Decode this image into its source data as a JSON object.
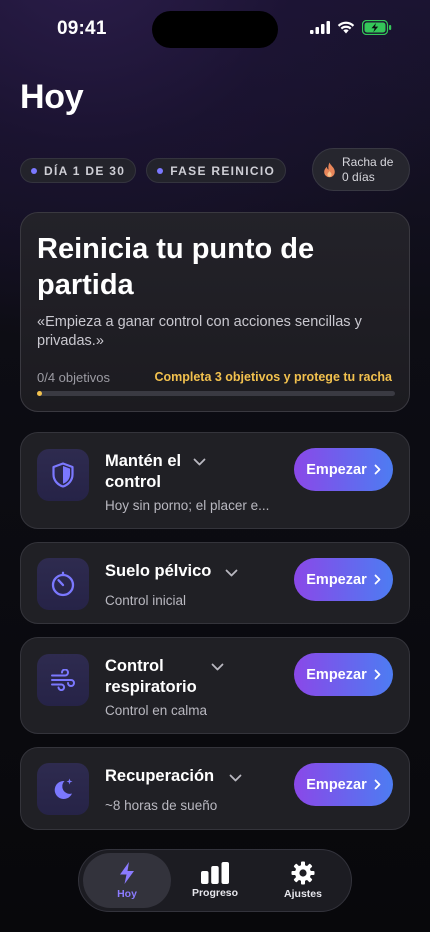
{
  "status_bar": {
    "time": "09:41"
  },
  "page": {
    "title": "Hoy"
  },
  "badges": {
    "day": "DÍA 1 DE 30",
    "phase": "FASE REINICIO"
  },
  "streak": {
    "line1": "Racha de",
    "line2": "0 días"
  },
  "hero": {
    "title": "Reinicia tu punto de partida",
    "quote": "«Empieza a ganar control con acciones sencillas y privadas.»",
    "progress_label": "0/4 objetivos",
    "hint": "Completa 3 objetivos y protege tu racha",
    "progress_fraction": 0
  },
  "tasks": [
    {
      "title": "Mantén el control",
      "subtitle": "Hoy sin porno; el placer e...",
      "button": "Empezar",
      "icon": "shield-icon"
    },
    {
      "title": "Suelo pélvico",
      "subtitle": "Control inicial",
      "button": "Empezar",
      "icon": "timer-icon"
    },
    {
      "title": "Control respiratorio",
      "subtitle": "Control en calma",
      "button": "Empezar",
      "icon": "wind-icon"
    },
    {
      "title": "Recuperación",
      "subtitle": "~8 horas de sueño",
      "button": "Empezar",
      "icon": "moon-icon"
    }
  ],
  "tabbar": {
    "items": [
      {
        "label": "Hoy",
        "icon": "bolt-icon",
        "active": true
      },
      {
        "label": "Progreso",
        "icon": "bars-icon",
        "active": false
      },
      {
        "label": "Ajustes",
        "icon": "gear-icon",
        "active": false
      }
    ]
  },
  "colors": {
    "accent": "#7b78ff",
    "hint": "#f2c14e",
    "button_gradient_start": "#8a48e8",
    "button_gradient_end": "#4d7cf2"
  }
}
